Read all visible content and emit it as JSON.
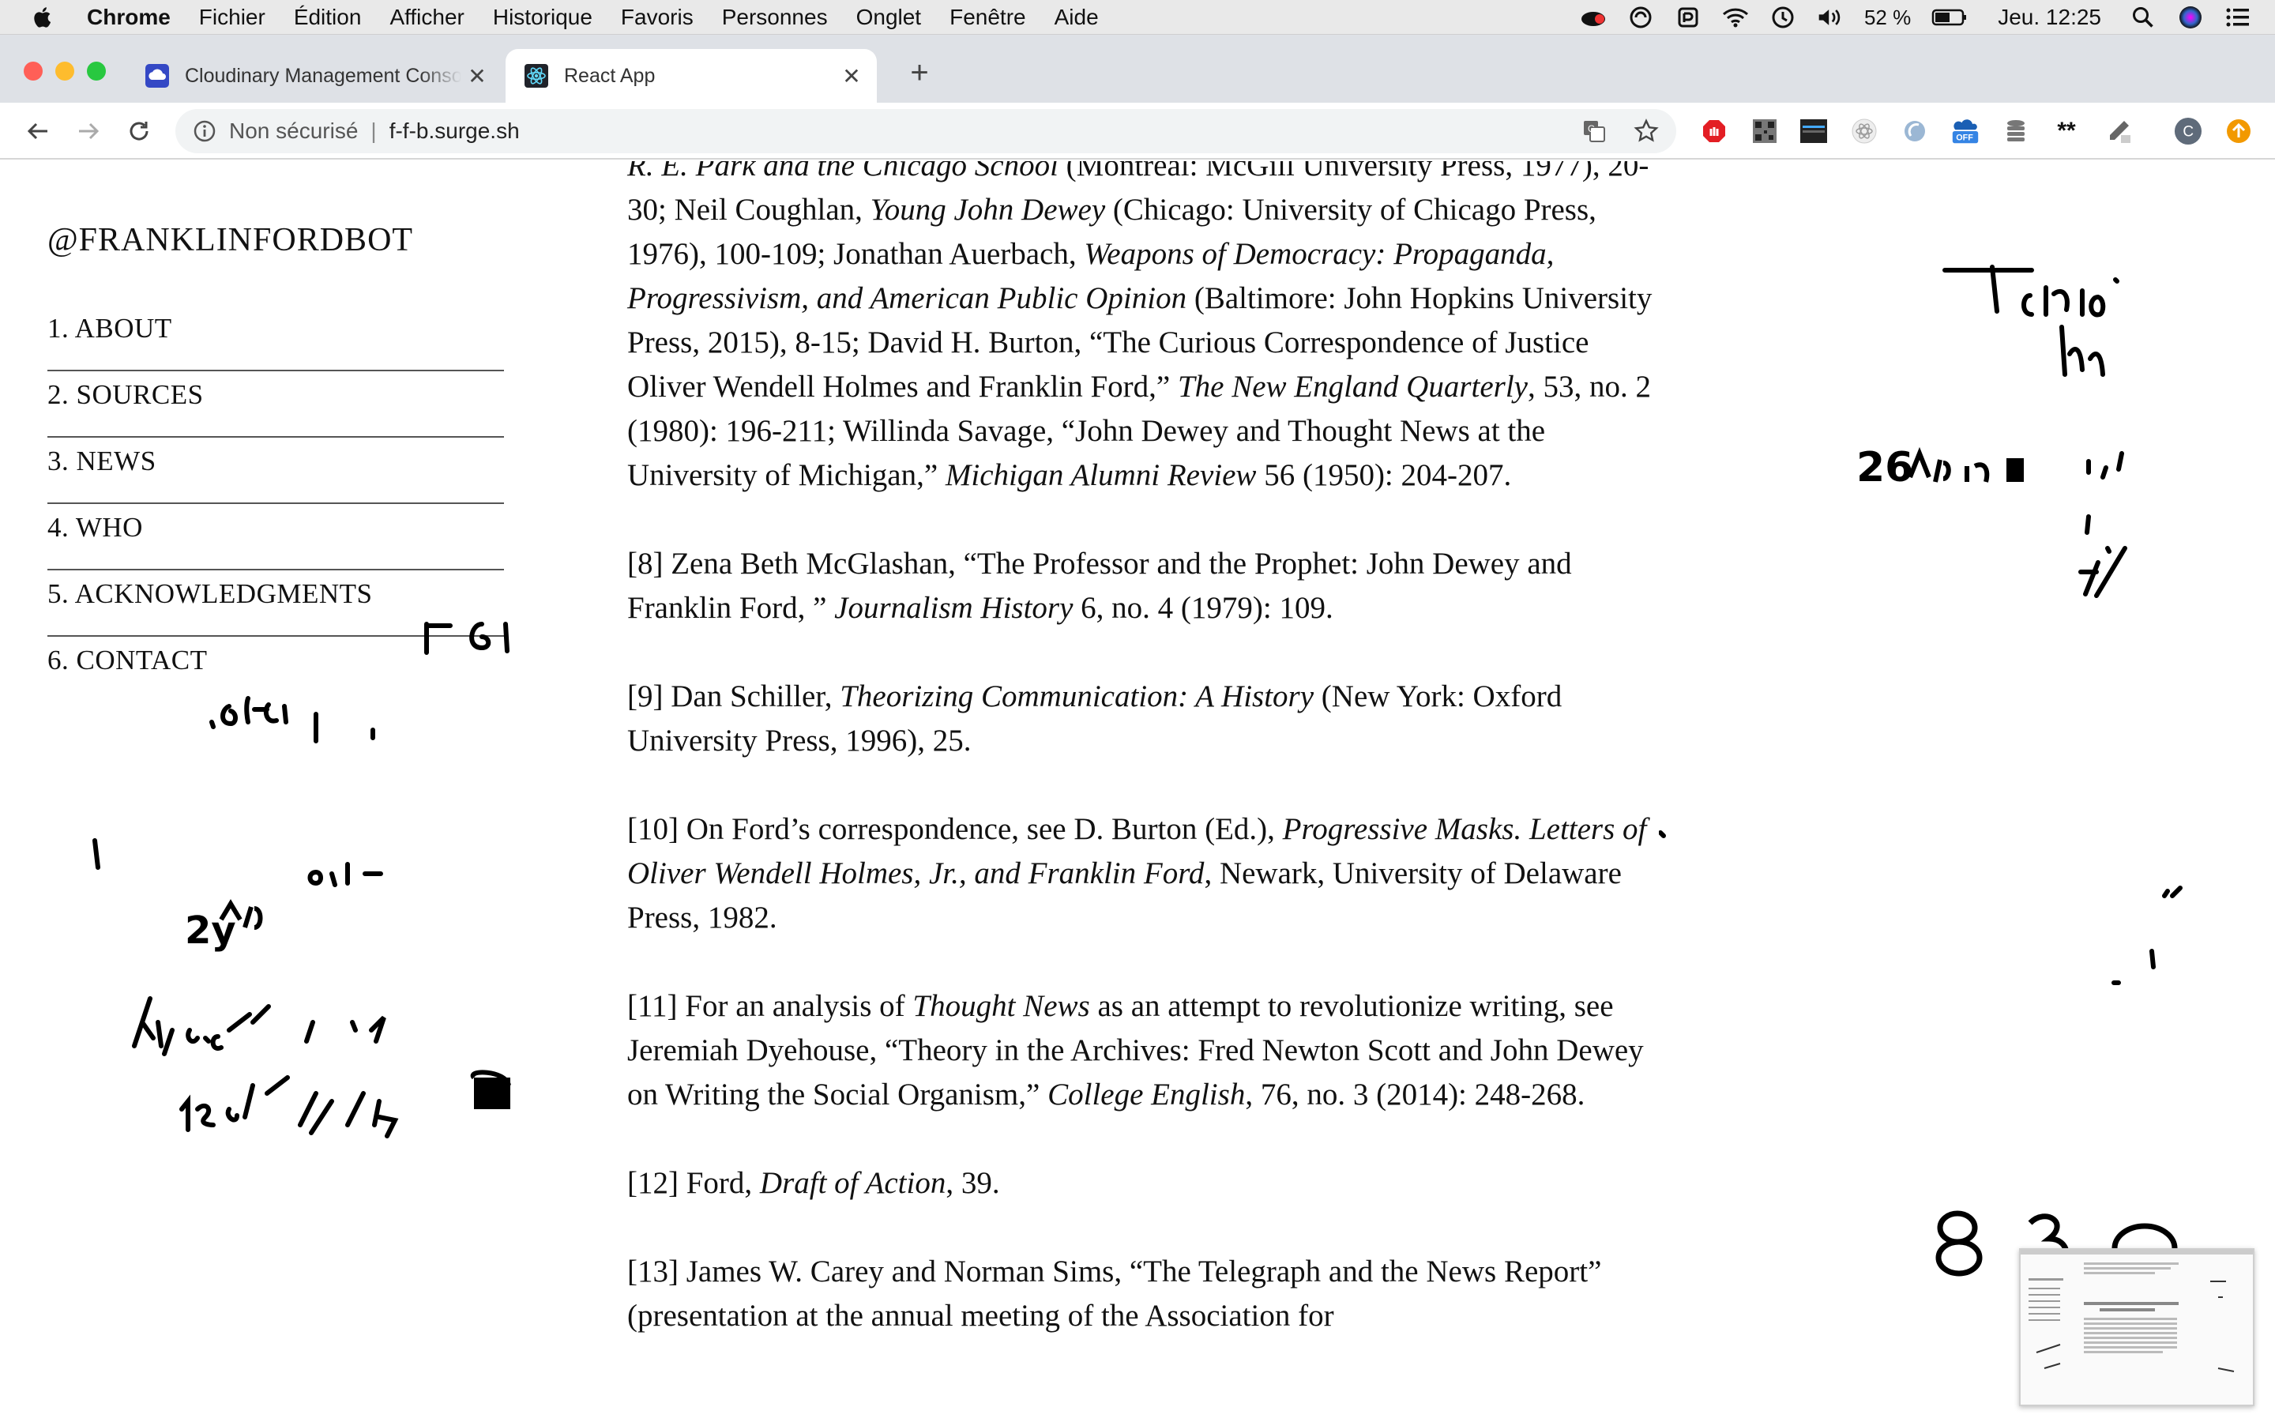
{
  "menubar": {
    "items": [
      "Chrome",
      "Fichier",
      "Édition",
      "Afficher",
      "Historique",
      "Favoris",
      "Personnes",
      "Onglet",
      "Fenêtre",
      "Aide"
    ],
    "battery": "52 %",
    "clock": "Jeu. 12:25"
  },
  "tabs": [
    {
      "title": "Cloudinary Management Console",
      "icon": "cloud-icon"
    },
    {
      "title": "React App",
      "icon": "react-icon"
    }
  ],
  "omnibox": {
    "security": "Non sécurisé",
    "url": "f-f-b.surge.sh"
  },
  "site": {
    "brand": "@FRANKLINFORDBOT",
    "nav": [
      "1. ABOUT",
      "2. SOURCES",
      "3. NEWS",
      "4. WHO",
      "5. ACKNOWLEDGMENTS",
      "6. CONTACT"
    ]
  },
  "article": {
    "p7": {
      "a": "R. E. Park and the Chicago School",
      "b": " (Montreal: McGill University Press, 1977), 20-30; Neil Coughlan, ",
      "c": "Young John Dewey",
      "d": " (Chicago: University of Chicago Press, 1976), 100-109; Jonathan Auerbach, ",
      "e": "Weapons of Democracy: Propaganda, Progressivism, and American Public Opinion",
      "f": " (Baltimore: John Hopkins University Press, 2015), 8-15; David H. Burton, “The Curious Correspondence of Justice Oliver Wendell Holmes and Franklin Ford,” ",
      "g": "The New England Quarterly",
      "h": ", 53, no. 2 (1980): 196-211; Willinda Savage, “John Dewey and Thought News at the University of Michigan,” ",
      "i": "Michigan Alumni Review",
      "j": " 56 (1950): 204-207."
    },
    "p8": {
      "a": "[8] Zena Beth McGlashan, “The Professor and the Prophet: John Dewey and Franklin Ford, ” ",
      "b": "Journalism History",
      "c": " 6, no. 4 (1979): 109."
    },
    "p9": {
      "a": "[9] Dan Schiller, ",
      "b": "Theorizing Communication: A History",
      "c": " (New York: Oxford University Press, 1996), 25."
    },
    "p10": {
      "a": "[10] On Ford’s correspondence, see D. Burton (Ed.), ",
      "b": "Progressive Masks. Letters of Oliver Wendell Holmes, Jr., and Franklin Ford",
      "c": ", Newark, University of Delaware Press, 1982."
    },
    "p11": {
      "a": "[11] For an analysis of ",
      "b": "Thought News",
      "c": " as an attempt to revolutionize writing, see Jeremiah Dyehouse, “Theory in the Archives: Fred Newton Scott and John Dewey on Writing the Social Organism,” ",
      "d": "College English",
      "e": ", 76, no. 3 (2014): 248-268."
    },
    "p12": {
      "a": "[12] Ford, ",
      "b": "Draft of Action",
      "c": ", 39."
    },
    "p13": {
      "a": "[13] James W. Carey and Norman Sims, “The Telegraph and the News Report” (presentation at the annual meeting of the Association for"
    }
  },
  "colors": {
    "accent_red": "#ff5f57",
    "accent_yellow": "#febc2e",
    "accent_green": "#28c840"
  }
}
